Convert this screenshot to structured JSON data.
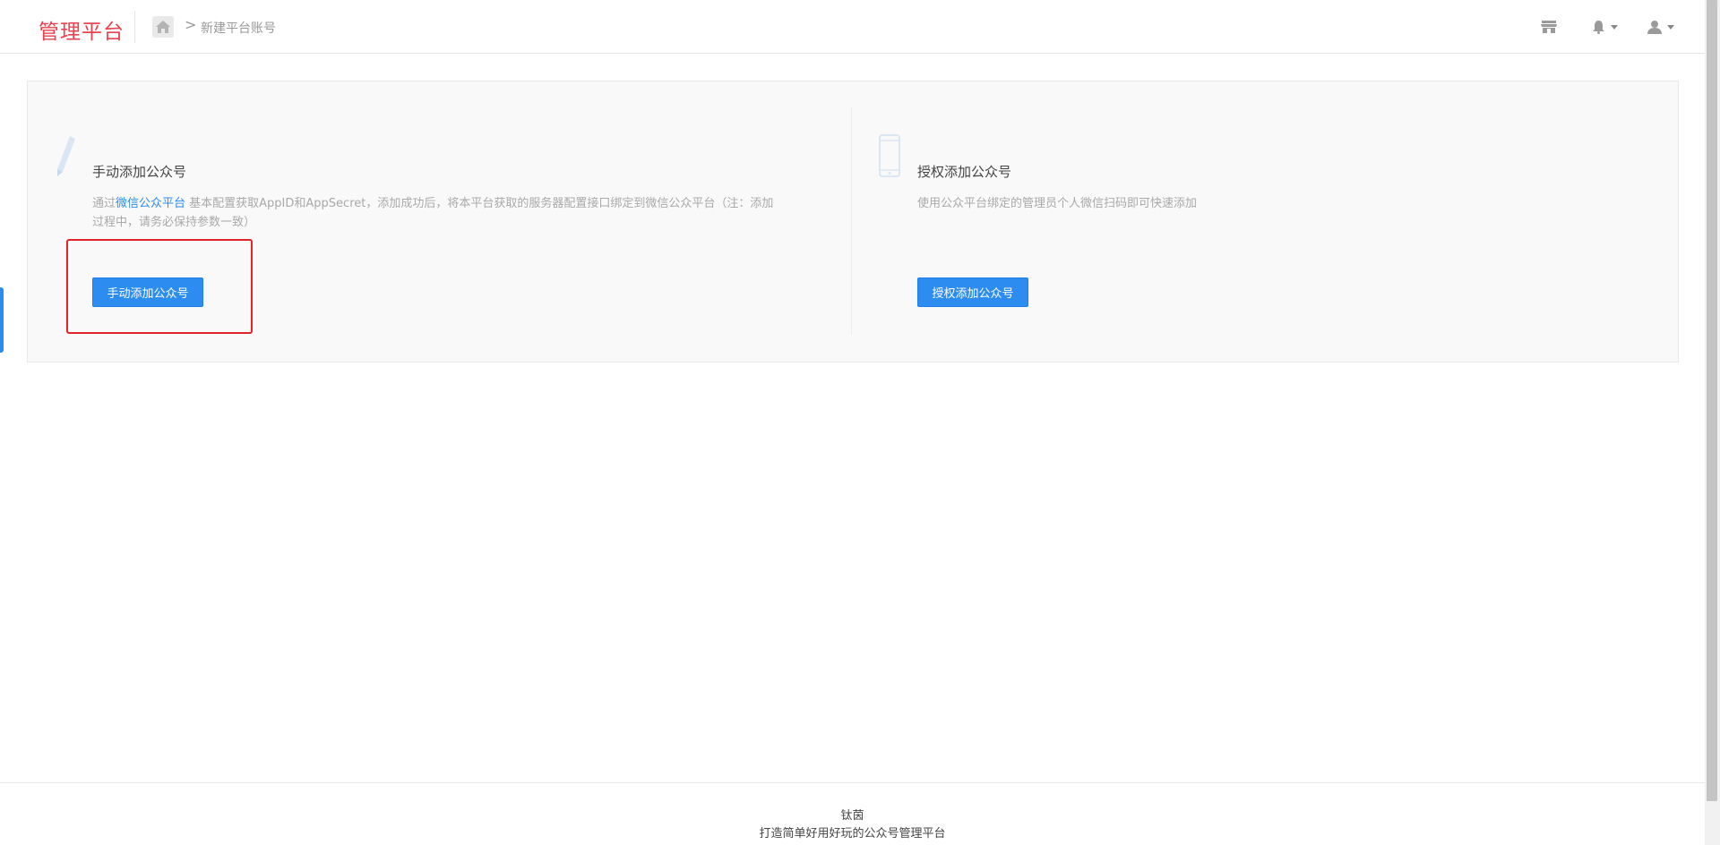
{
  "header": {
    "logo": "管理平台",
    "breadcrumb": {
      "home_icon": "home-icon",
      "separator": ">",
      "current": "新建平台账号"
    },
    "icons": [
      "store-icon",
      "bell-icon",
      "user-icon"
    ]
  },
  "cards": {
    "manual": {
      "icon": "pencil-icon",
      "title": "手动添加公众号",
      "desc_prefix": "通过",
      "desc_link": "微信公众平台",
      "desc_line1_rest": " 基本配置获取AppID和AppSecret，添加成功后，将本平台获取的服务器配置接口绑定到微信公众平台（注：添加",
      "desc_line2": "过程中，请务必保持参数一致）",
      "button": "手动添加公众号"
    },
    "authorize": {
      "icon": "phone-icon",
      "title": "授权添加公众号",
      "desc": "使用公众平台绑定的管理员个人微信扫码即可快速添加",
      "button": "授权添加公众号"
    }
  },
  "footer": {
    "line1": "钛茵",
    "line2": "打造简单好用好玩的公众号管理平台"
  },
  "colors": {
    "brand": "#e8434e",
    "accent": "#2d8cf0",
    "highlight": "#e3242b"
  }
}
